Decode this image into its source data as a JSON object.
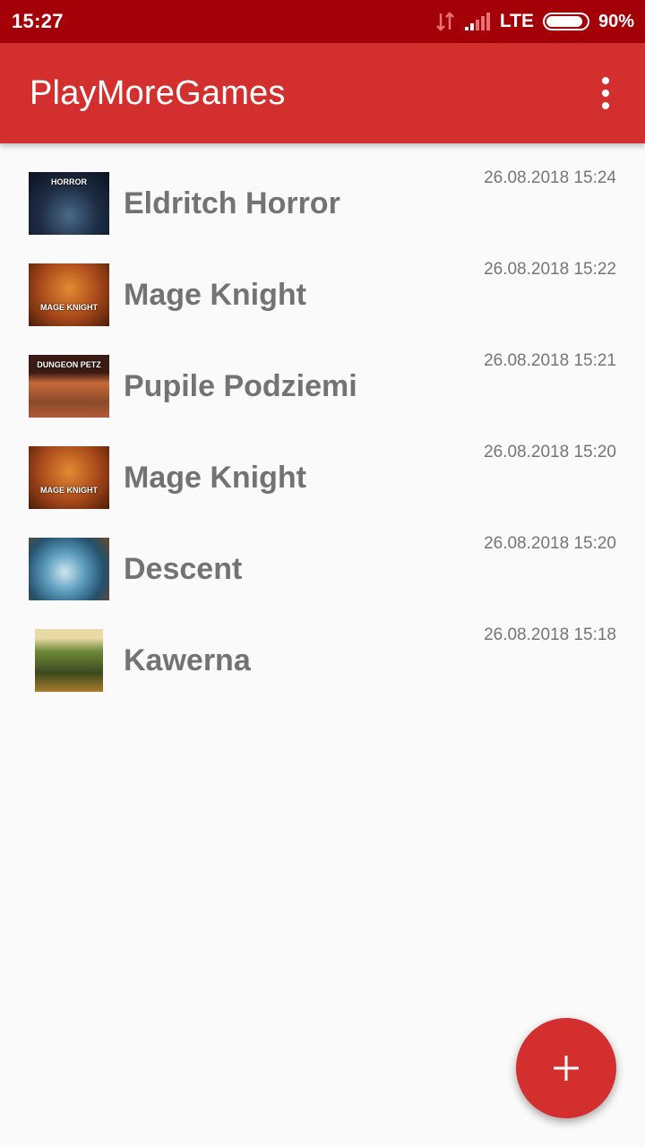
{
  "status_bar": {
    "time": "15:27",
    "network": "LTE",
    "battery_percent": "90%",
    "battery_level": 0.9
  },
  "app_bar": {
    "title": "PlayMoreGames"
  },
  "games": [
    {
      "name": "Eldritch Horror",
      "date": "26.08.2018 15:24",
      "thumb_text": "HORROR"
    },
    {
      "name": "Mage Knight",
      "date": "26.08.2018 15:22",
      "thumb_text": "MAGE KNIGHT"
    },
    {
      "name": "Pupile Podziemi",
      "date": "26.08.2018 15:21",
      "thumb_text": "DUNGEON PETZ"
    },
    {
      "name": "Mage Knight",
      "date": "26.08.2018 15:20",
      "thumb_text": "MAGE KNIGHT"
    },
    {
      "name": "Descent",
      "date": "26.08.2018 15:20",
      "thumb_text": ""
    },
    {
      "name": "Kawerna",
      "date": "26.08.2018 15:18",
      "thumb_text": ""
    }
  ],
  "fab": {
    "icon": "plus-icon"
  },
  "colors": {
    "status_bar": "#a30008",
    "app_bar": "#d32f2f",
    "accent": "#d32f2f",
    "text_secondary": "#757575"
  }
}
